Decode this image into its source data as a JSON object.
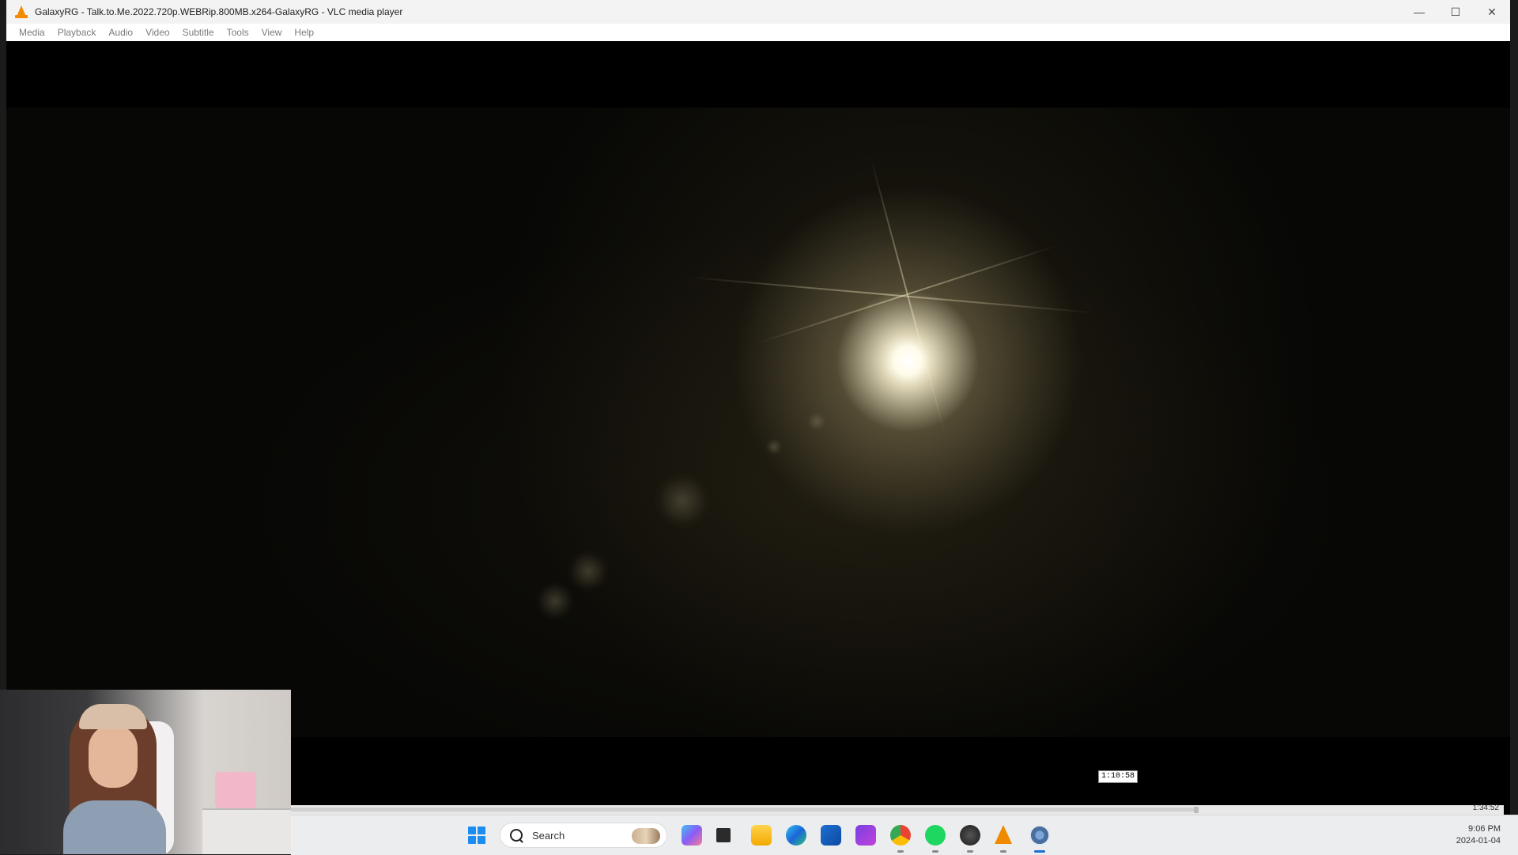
{
  "window": {
    "title": "GalaxyRG - Talk.to.Me.2022.720p.WEBRip.800MB.x264-GalaxyRG - VLC media player",
    "app_icon": "vlc-cone-icon",
    "controls": {
      "minimize": "—",
      "maximize": "☐",
      "close": "✕"
    }
  },
  "menu": {
    "items": [
      {
        "label": "Media"
      },
      {
        "label": "Playback"
      },
      {
        "label": "Audio"
      },
      {
        "label": "Video"
      },
      {
        "label": "Subtitle"
      },
      {
        "label": "Tools"
      },
      {
        "label": "View"
      },
      {
        "label": "Help"
      }
    ]
  },
  "player": {
    "hover_time": "1:10:58",
    "total_time": "1:34:52",
    "progress": 0.748
  },
  "taskbar": {
    "search_placeholder": "Search",
    "clock_time": "9:06 PM",
    "clock_date": "2024-01-04",
    "pinned_icons": [
      "copilot-icon",
      "task-view-icon",
      "file-explorer-icon",
      "edge-icon",
      "microsoft-store-icon",
      "clipchamp-icon",
      "chrome-icon",
      "spotify-icon",
      "davinci-resolve-icon",
      "vlc-icon",
      "settings-icon"
    ]
  },
  "colors": {
    "vlc_orange": "#f08a00",
    "windows_blue": "#1b8cf0",
    "spotify_green": "#1ed760"
  }
}
